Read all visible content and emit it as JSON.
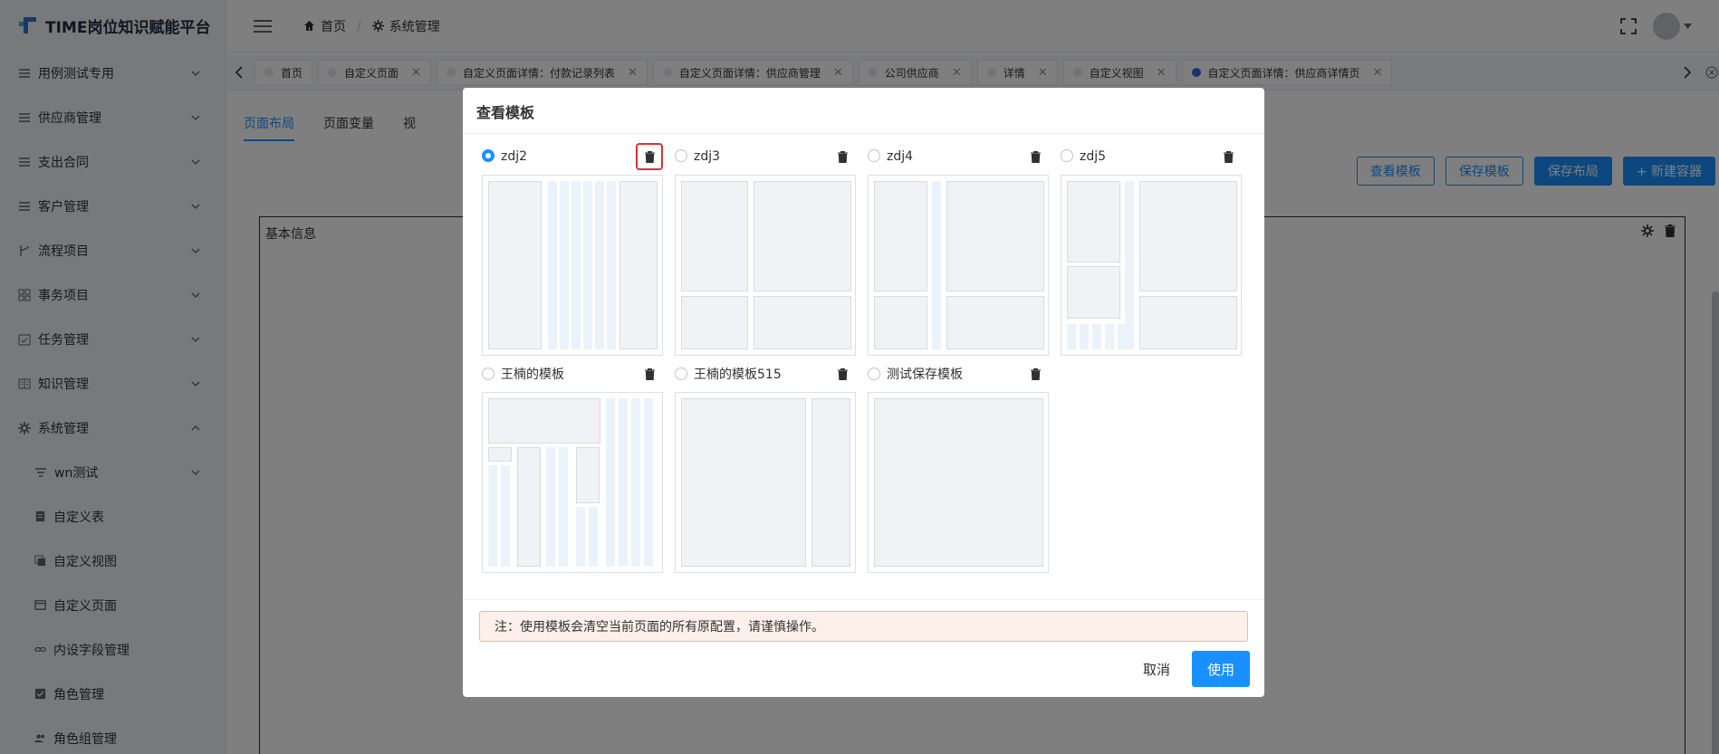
{
  "app": {
    "title": "TIME岗位知识赋能平台",
    "accent": "#1890ff",
    "logo_colors": [
      "#2a6fdb",
      "#3fb8ae"
    ]
  },
  "breadcrumb": [
    {
      "label": "首页",
      "icon": "home-icon"
    },
    {
      "label": "系统管理",
      "icon": "gear-icon"
    }
  ],
  "sidebar": {
    "items": [
      {
        "label": "用例测试专用",
        "icon": "list-icon",
        "expanded": false
      },
      {
        "label": "供应商管理",
        "icon": "list-icon",
        "expanded": false
      },
      {
        "label": "支出合同",
        "icon": "list-icon",
        "expanded": false
      },
      {
        "label": "客户管理",
        "icon": "list-icon",
        "expanded": false
      },
      {
        "label": "流程项目",
        "icon": "branch-icon",
        "expanded": false
      },
      {
        "label": "事务项目",
        "icon": "grid-icon",
        "expanded": false
      },
      {
        "label": "任务管理",
        "icon": "calendar-check-icon",
        "expanded": false
      },
      {
        "label": "知识管理",
        "icon": "book-icon",
        "expanded": false
      },
      {
        "label": "系统管理",
        "icon": "gear-icon",
        "expanded": true
      }
    ],
    "sub_items": [
      {
        "label": "wn测试",
        "icon": "filter-icon",
        "expanded": false
      },
      {
        "label": "自定义表",
        "icon": "form-icon"
      },
      {
        "label": "自定义视图",
        "icon": "copy-icon"
      },
      {
        "label": "自定义页面",
        "icon": "window-icon"
      },
      {
        "label": "内设字段管理",
        "icon": "link-icon"
      },
      {
        "label": "角色管理",
        "icon": "checkbox-icon"
      },
      {
        "label": "角色组管理",
        "icon": "users-icon"
      }
    ]
  },
  "tags": [
    {
      "label": "首页",
      "closable": false,
      "active": false
    },
    {
      "label": "自定义页面",
      "closable": true,
      "active": false
    },
    {
      "label": "自定义页面详情：付款记录列表",
      "closable": true,
      "active": false
    },
    {
      "label": "自定义页面详情：供应商管理",
      "closable": true,
      "active": false
    },
    {
      "label": "公司供应商",
      "closable": true,
      "active": false
    },
    {
      "label": "详情",
      "closable": true,
      "active": false
    },
    {
      "label": "自定义视图",
      "closable": true,
      "active": false
    },
    {
      "label": "自定义页面详情：供应商详情页",
      "closable": true,
      "active": true
    }
  ],
  "content": {
    "tabs": [
      "页面布局",
      "页面变量",
      "视"
    ],
    "active_tab": "页面布局",
    "buttons": {
      "view_template": "查看模板",
      "save_template": "保存模板",
      "save_layout": "保存布局",
      "new_container": "+ 新建容器"
    },
    "container_title": "基本信息"
  },
  "dialog": {
    "title": "查看模板",
    "templates": [
      {
        "name": "zdj2",
        "selected": true
      },
      {
        "name": "zdj3",
        "selected": false
      },
      {
        "name": "zdj4",
        "selected": false
      },
      {
        "name": "zdj5",
        "selected": false
      },
      {
        "name": "王楠的模板",
        "selected": false
      },
      {
        "name": "王楠的模板515",
        "selected": false
      },
      {
        "name": "测试保存模板",
        "selected": false
      }
    ],
    "note": "注：使用模板会清空当前页面的所有原配置，请谨慎操作。",
    "cancel": "取消",
    "confirm": "使用",
    "highlight_color": "#e0302c"
  }
}
